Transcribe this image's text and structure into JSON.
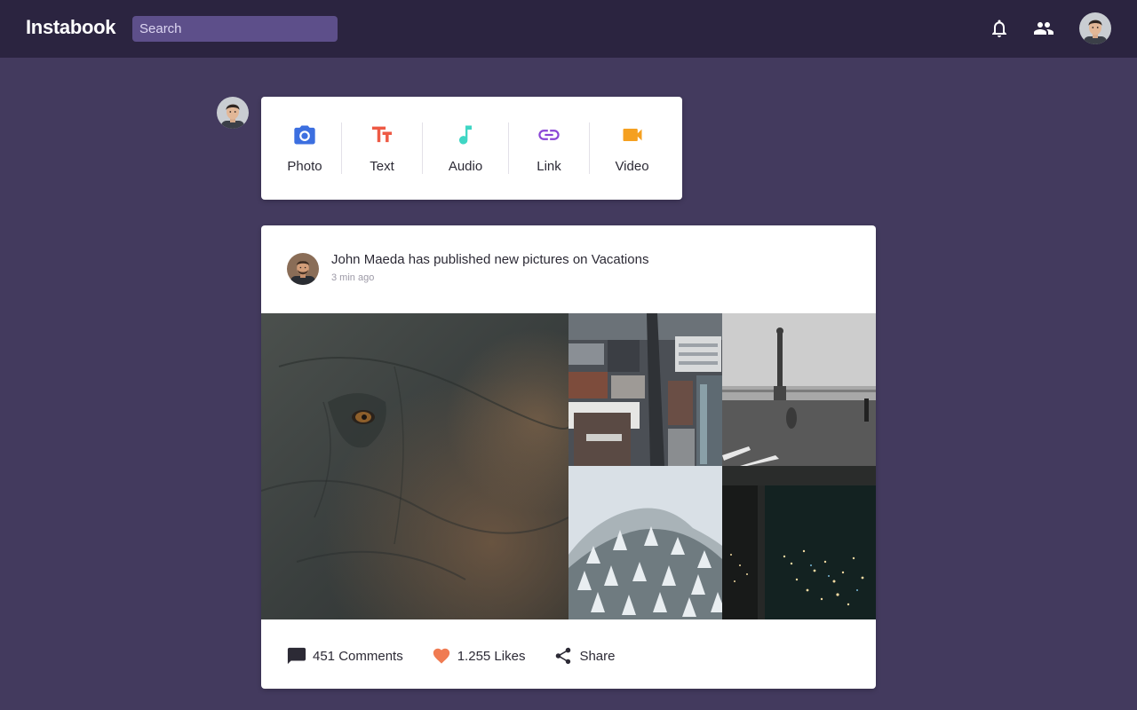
{
  "app": {
    "name": "Instabook"
  },
  "search": {
    "placeholder": "Search"
  },
  "composer": {
    "items": [
      {
        "id": "photo",
        "label": "Photo",
        "icon": "camera-icon",
        "color": "#3c6fe0"
      },
      {
        "id": "text",
        "label": "Text",
        "icon": "text-icon",
        "color": "#ee5a45"
      },
      {
        "id": "audio",
        "label": "Audio",
        "icon": "music-note-icon",
        "color": "#3fd6c4"
      },
      {
        "id": "link",
        "label": "Link",
        "icon": "link-icon",
        "color": "#8a45d6"
      },
      {
        "id": "video",
        "label": "Video",
        "icon": "videocam-icon",
        "color": "#f5a020"
      }
    ]
  },
  "post": {
    "title": "John Maeda has published new pictures on Vacations",
    "time": "3 min ago",
    "comments_label": "451 Comments",
    "likes_label": "1.255 Likes",
    "share_label": "Share"
  },
  "colors": {
    "background": "#433a5e",
    "topbar": "#2b2440",
    "search_bg": "#5d4f8a",
    "like_heart": "#f07b52"
  }
}
